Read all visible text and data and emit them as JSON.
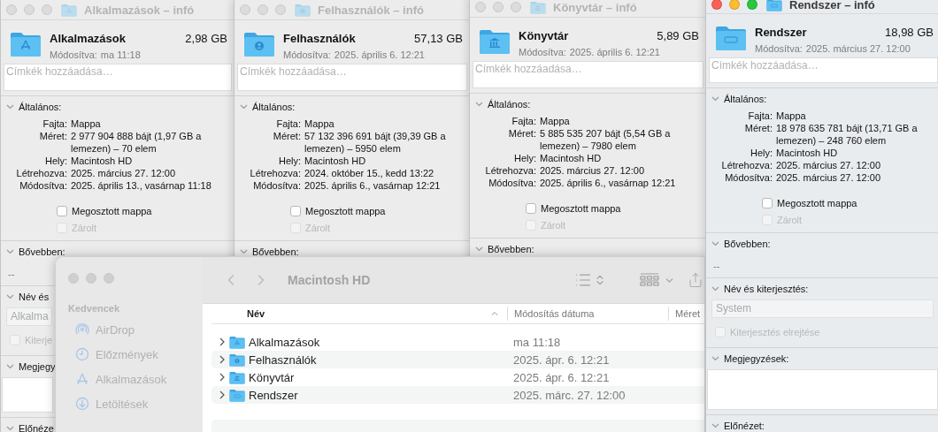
{
  "info_windows": [
    {
      "title": "Alkalmazások – infó",
      "active": false,
      "kind": "apps",
      "name": "Alkalmazások",
      "size": "2,98 GB",
      "modified_label": "Módosítva:",
      "modified": "ma 11:18",
      "tags_placeholder": "Címkék hozzáadása…",
      "general_title": "Általános:",
      "fields": [
        {
          "label": "Fajta:",
          "value": "Mappa"
        },
        {
          "label": "Méret:",
          "value": "2 977 904 888 bájt (1,97 GB a lemezen) – 70 elem"
        },
        {
          "label": "Hely:",
          "value": "Macintosh HD"
        },
        {
          "label": "Létrehozva:",
          "value": "2025. március 27. 12:00"
        },
        {
          "label": "Módosítva:",
          "value": "2025. április 13., vasárnap 11:18"
        }
      ],
      "checkboxes": [
        {
          "label": "Megosztott mappa",
          "checked": false,
          "disabled": false
        },
        {
          "label": "Zárolt",
          "checked": false,
          "disabled": true
        }
      ],
      "sections": [
        {
          "kind": "value",
          "title": "Bővebben:",
          "value": "--"
        },
        {
          "kind": "name",
          "title": "Név és",
          "value": "Alkalma",
          "checkbox": {
            "label": "Kiterje",
            "checked": false,
            "disabled": true
          }
        },
        {
          "kind": "notes",
          "title": "Megjegy"
        },
        {
          "kind": "header",
          "title": "Előnéze"
        }
      ]
    },
    {
      "title": "Felhasználók – infó",
      "active": false,
      "kind": "user",
      "name": "Felhasználók",
      "size": "57,13 GB",
      "modified_label": "Módosítva:",
      "modified": "2025. április 6. 12:21",
      "tags_placeholder": "Címkék hozzáadása…",
      "general_title": "Általános:",
      "fields": [
        {
          "label": "Fajta:",
          "value": "Mappa"
        },
        {
          "label": "Méret:",
          "value": "57 132 396 691 bájt (39,39 GB a lemezen) – 5950 elem"
        },
        {
          "label": "Hely:",
          "value": "Macintosh HD"
        },
        {
          "label": "Létrehozva:",
          "value": "2024. október 15., kedd 13:22"
        },
        {
          "label": "Módosítva:",
          "value": "2025. április 6., vasárnap 12:21"
        }
      ],
      "checkboxes": [
        {
          "label": "Megosztott mappa",
          "checked": false,
          "disabled": false
        },
        {
          "label": "Zárolt",
          "checked": false,
          "disabled": true
        }
      ],
      "sections": [
        {
          "kind": "header",
          "title": "Bővebben:"
        }
      ]
    },
    {
      "title": "Könyvtár – infó",
      "active": false,
      "kind": "library",
      "name": "Könyvtár",
      "size": "5,89 GB",
      "modified_label": "Módosítva:",
      "modified": "2025. április 6. 12:21",
      "tags_placeholder": "Címkék hozzáadása…",
      "general_title": "Általános:",
      "fields": [
        {
          "label": "Fajta:",
          "value": "Mappa"
        },
        {
          "label": "Méret:",
          "value": "5 885 535 207 bájt (5,54 GB a lemezen) – 7980 elem"
        },
        {
          "label": "Hely:",
          "value": "Macintosh HD"
        },
        {
          "label": "Létrehozva:",
          "value": "2025. március 27. 12:00"
        },
        {
          "label": "Módosítva:",
          "value": "2025. április 6., vasárnap 12:21"
        }
      ],
      "checkboxes": [
        {
          "label": "Megosztott mappa",
          "checked": false,
          "disabled": false
        },
        {
          "label": "Zárolt",
          "checked": false,
          "disabled": true
        }
      ],
      "sections": [
        {
          "kind": "header",
          "title": "Bővebben:"
        }
      ]
    },
    {
      "title": "Rendszer – infó",
      "active": true,
      "kind": "macos",
      "name": "Rendszer",
      "size": "18,98 GB",
      "modified_label": "Módosítva:",
      "modified": "2025. március 27. 12:00",
      "tags_placeholder": "Címkék hozzáadása…",
      "general_title": "Általános:",
      "fields": [
        {
          "label": "Fajta:",
          "value": "Mappa"
        },
        {
          "label": "Méret:",
          "value": "18 978 635 781 bájt (13,71 GB a lemezen) – 248 760 elem"
        },
        {
          "label": "Hely:",
          "value": "Macintosh HD"
        },
        {
          "label": "Létrehozva:",
          "value": "2025. március 27. 12:00"
        },
        {
          "label": "Módosítva:",
          "value": "2025. március 27. 12:00"
        }
      ],
      "checkboxes": [
        {
          "label": "Megosztott mappa",
          "checked": false,
          "disabled": false
        },
        {
          "label": "Zárolt",
          "checked": false,
          "disabled": true
        }
      ],
      "sections": [
        {
          "kind": "value",
          "title": "Bővebben:",
          "value": "--"
        },
        {
          "kind": "name",
          "title": "Név és kiterjesztés:",
          "value": "System",
          "checkbox": {
            "label": "Kiterjesztés elrejtése",
            "checked": false,
            "disabled": true
          }
        },
        {
          "kind": "notes",
          "title": "Megjegyzések:"
        },
        {
          "kind": "header",
          "title": "Előnézet:"
        }
      ]
    }
  ],
  "finder": {
    "title": "Macintosh HD",
    "active": false,
    "sidebar": {
      "heading": "Kedvencek",
      "items": [
        {
          "label": "AirDrop",
          "kind": "airdrop",
          "selected": false
        },
        {
          "label": "Előzmények",
          "kind": "recents",
          "selected": false
        },
        {
          "label": "Alkalmazások",
          "kind": "apps",
          "selected": false
        },
        {
          "label": "Letöltések",
          "kind": "downloads",
          "selected": false
        }
      ]
    },
    "columns": [
      {
        "label": "Név",
        "sorted": true
      },
      {
        "label": "Módosítás dátuma",
        "sorted": false
      },
      {
        "label": "Méret",
        "sorted": false
      }
    ],
    "rows": [
      {
        "name": "Alkalmazások",
        "kind": "apps",
        "modified": "ma 11:18",
        "expanded": false
      },
      {
        "name": "Felhasználók",
        "kind": "user",
        "modified": "2025. ápr. 6. 12:21",
        "expanded": false
      },
      {
        "name": "Könyvtár",
        "kind": "library",
        "modified": "2025. ápr. 6. 12:21",
        "expanded": false
      },
      {
        "name": "Rendszer",
        "kind": "macos",
        "modified": "2025. márc. 27. 12:00",
        "expanded": false
      }
    ]
  }
}
